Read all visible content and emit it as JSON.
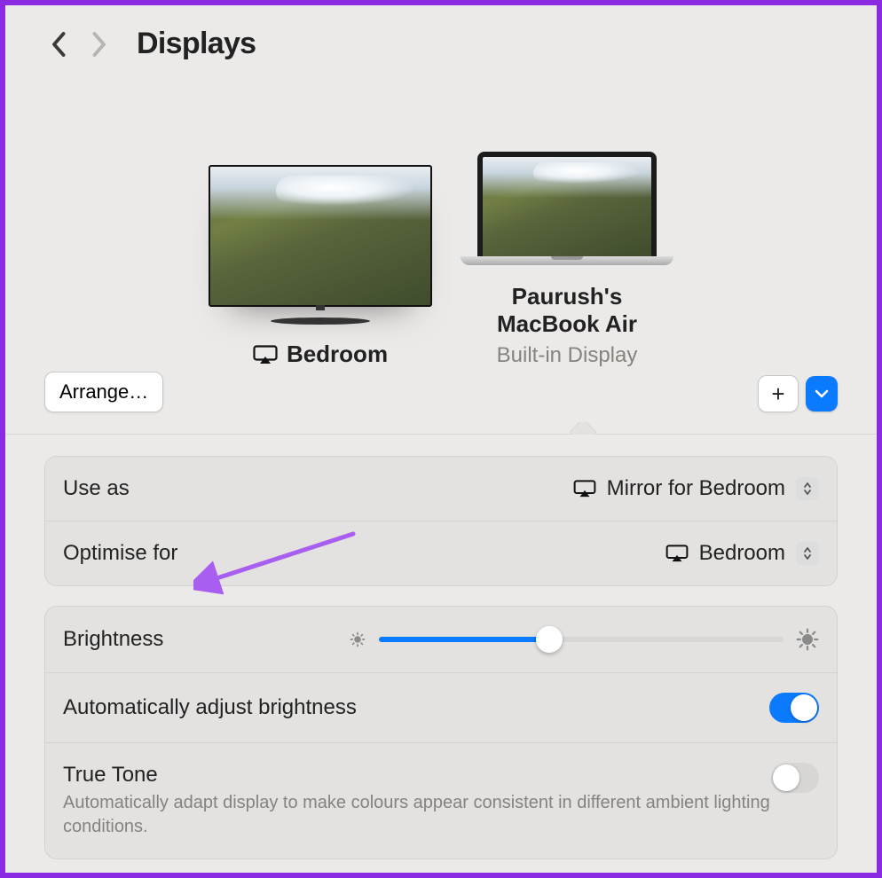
{
  "header": {
    "title": "Displays"
  },
  "displays": {
    "primary": {
      "name": "Bedroom"
    },
    "secondary": {
      "name_line1": "Paurush's",
      "name_line2": "MacBook Air",
      "subtitle": "Built-in Display"
    }
  },
  "buttons": {
    "arrange": "Arrange…",
    "add": "+"
  },
  "settings": {
    "use_as": {
      "label": "Use as",
      "value": "Mirror for Bedroom"
    },
    "optimise_for": {
      "label": "Optimise for",
      "value": "Bedroom"
    },
    "brightness": {
      "label": "Brightness",
      "value_percent": 42
    },
    "auto_brightness": {
      "label": "Automatically adjust brightness",
      "enabled": true
    },
    "true_tone": {
      "label": "True Tone",
      "description": "Automatically adapt display to make colours appear consistent in different ambient lighting conditions.",
      "enabled": false
    }
  }
}
